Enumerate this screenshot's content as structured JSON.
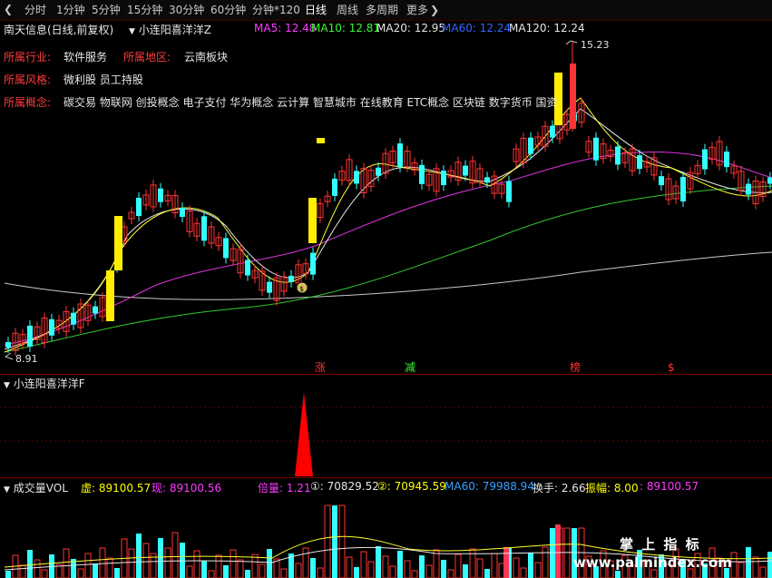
{
  "toolbar": {
    "back_icon": "chevron-left-icon",
    "items": [
      "分时",
      "1分钟",
      "5分钟",
      "15分钟",
      "30分钟",
      "60分钟",
      "分钟*120",
      "日线",
      "周线",
      "多周期",
      "更多"
    ],
    "active": "日线",
    "more_icon": "chevron-right-icon"
  },
  "main_panel": {
    "stock_title": "南天信息(日线,前复权)",
    "indicator_name": "小连阳喜洋洋Z",
    "ma": [
      {
        "label": "MA5: 12.48",
        "color": "#ff39ff"
      },
      {
        "label": "MA10: 12.81",
        "color": "#33ff33"
      },
      {
        "label": "MA20: 12.95",
        "color": "#e6e6e6"
      },
      {
        "label": "MA60: 12.24",
        "color": "#3366ff"
      },
      {
        "label": "MA120: 12.24",
        "color": "#e6e6e6"
      }
    ],
    "industry_label": "所属行业:",
    "industry_value": "软件服务",
    "region_label": "所属地区:",
    "region_value": "云南板块",
    "style_label": "所属风格:",
    "style_value": "微利股 员工持股",
    "concept_label": "所属概念:",
    "concept_value": "碳交易 物联网 创投概念 电子支付 华为概念 云计算 智慧城市 在线教育 ETC概念 区块链 数字货币 国资",
    "high_price": "15.23",
    "low_price": "8.91",
    "markers": [
      {
        "text": "涨",
        "color": "#ff3333"
      },
      {
        "text": "减",
        "color": "#33ff33"
      },
      {
        "text": "榜",
        "color": "#ff3333"
      },
      {
        "text": "$",
        "color": "#ff3333"
      }
    ],
    "coin_icon": "coin-icon"
  },
  "sub_panel": {
    "indicator_name": "小连阳喜洋洋F"
  },
  "volume_panel": {
    "title": "成交量VOL",
    "items": [
      {
        "label": "虚: 89100.57",
        "color": "#ffff00"
      },
      {
        "label": "现: 89100.56",
        "color": "#ff39ff"
      },
      {
        "label": "倍量: 1.21",
        "color": "#ff39ff"
      },
      {
        "label": "①: 70829.52",
        "color": "#e6e6e6"
      },
      {
        "label": "②: 70945.59",
        "color": "#ffff00"
      },
      {
        "label": "MA60: 79988.94",
        "color": "#3aa0ff"
      },
      {
        "label": "换手: 2.66",
        "color": "#e6e6e6"
      },
      {
        "label": "振幅: 8.00",
        "color": "#ffff00"
      },
      {
        "label": ": 89100.57",
        "color": "#ff39ff"
      }
    ]
  },
  "watermark": {
    "line1": "掌 上 指 标",
    "line2": "www.palmindex.com"
  }
}
